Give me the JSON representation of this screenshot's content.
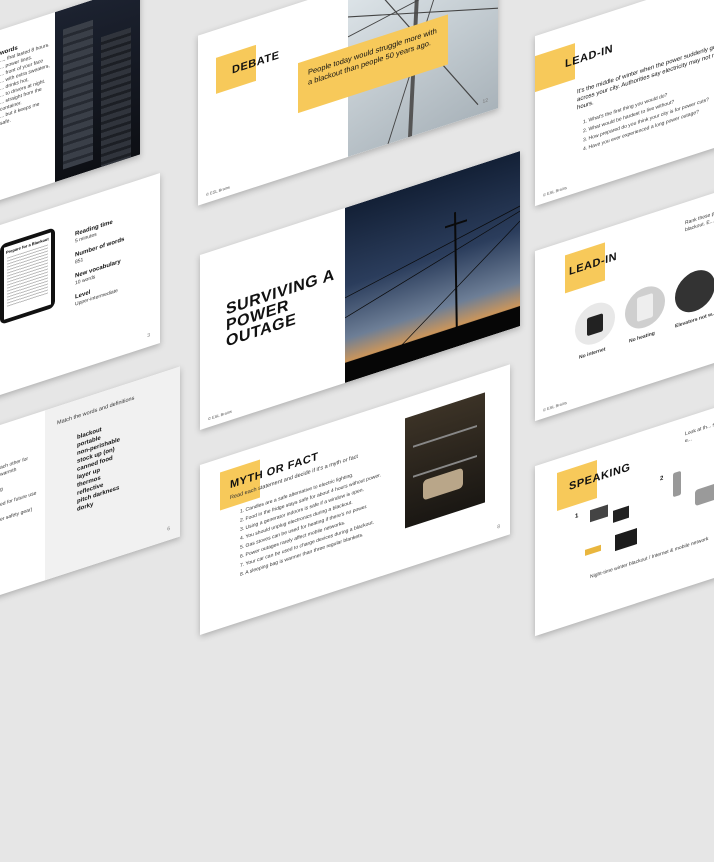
{
  "slides": {
    "debate": {
      "title": "DEBATE",
      "quote": "People today would struggle more with a blackout than people 50 years ago.",
      "page": "12"
    },
    "leadin1": {
      "title": "LEAD-IN",
      "intro": "It's the middle of winter when the power suddenly goes out across your city. Authorities say electricity may not return for 24 hours.",
      "questions": [
        "1. What's the first thing you would do?",
        "2. What would be hardest to live without?",
        "3. How prepared do you think your city is for power cuts?",
        "4. Have you ever experienced a long power outage?"
      ]
    },
    "cover": {
      "title": "SURVIVING A POWER OUTAGE"
    },
    "info": {
      "doc_title": "Prepare for a Blackout",
      "items": [
        {
          "label": "Reading time",
          "value": "5 minutes"
        },
        {
          "label": "Number of words",
          "value": "851"
        },
        {
          "label": "New vocabulary",
          "value": "10 words"
        },
        {
          "label": "Level",
          "value": "Upper-intermediate"
        }
      ],
      "page": "3"
    },
    "leadin2": {
      "title": "LEAD-IN",
      "instruction": "Rank these pr... a blackout. E...",
      "labels": [
        "No internet",
        "No heating",
        "Elevators not w..."
      ]
    },
    "match": {
      "instruction": "Match the words and definitions",
      "words": [
        "blackout",
        "portable",
        "non-perishable",
        "stock up (on)",
        "canned food",
        "layer up",
        "thermos",
        "reflective",
        "pitch darkness",
        "dorky"
      ],
      "page": "6",
      "left_fragments": [
        "ach other for warmth",
        "g",
        "ed for future use",
        "er safety gear)"
      ]
    },
    "myth": {
      "title": "MYTH OR FACT",
      "instruction": "Read each statement and decide if it's a myth or fact",
      "statements": [
        "1. Candles are a safe alternative to electric lighting.",
        "2. Food in the fridge stays safe for about 4 hours without power.",
        "3. Using a generator indoors is safe if a window is open.",
        "4. You should unplug electronics during a blackout.",
        "5. Gas stoves can be used for heating if there's no power.",
        "6. Power outages rarely affect mobile networks.",
        "7. Your car can be used to charge devices during a blackout.",
        "8. A sleeping bag is warmer than three regular blankets."
      ],
      "page": "8"
    },
    "speaking": {
      "title": "SPEAKING",
      "instruction": "Look at th... situation e...",
      "caption": "Night-time winter blackout  /  Internet & mobile network"
    },
    "words_left": {
      "heading": "words",
      "lines": [
        "..., that lasted 8 hours.",
        "... power lines.",
        "... front of your face",
        "... with extra sweaters,",
        "... drinks hot,",
        "... to drivers at night.",
        "... straight from the container.",
        "... but it keeps me safe."
      ]
    },
    "footer_brand": "© ESL Brains"
  },
  "colors": {
    "accent": "#f7c95a",
    "background": "#e6e6e6"
  }
}
